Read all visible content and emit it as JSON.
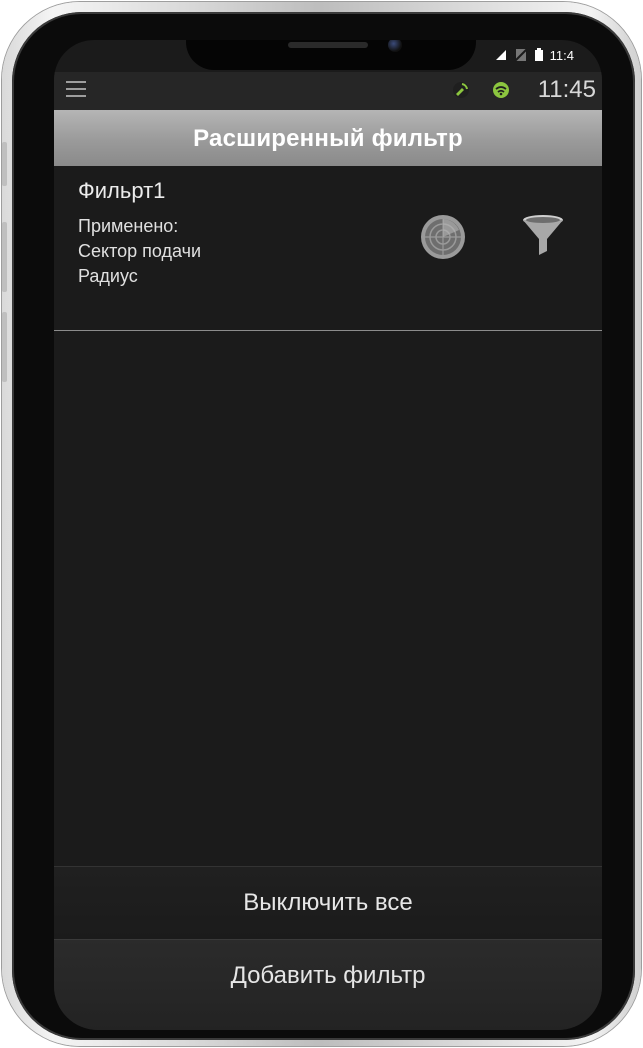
{
  "device": {
    "status_time_short": "11:4",
    "status_left_glyph": "◂"
  },
  "app_status": {
    "time": "11:45",
    "icons": [
      "menu-icon",
      "satellite-icon",
      "wifi-signal-icon"
    ],
    "accent_color": "#8cc63f"
  },
  "header": {
    "title": "Расширенный фильтр"
  },
  "filters": [
    {
      "name": "Фильрт1",
      "applied_label": "Применено:",
      "applied": [
        "Сектор подачи",
        "Радиус"
      ],
      "icons": [
        "radar-icon",
        "filter-funnel-icon"
      ]
    }
  ],
  "actions": {
    "disable_all": "Выключить все",
    "add_filter": "Добавить фильтр"
  }
}
